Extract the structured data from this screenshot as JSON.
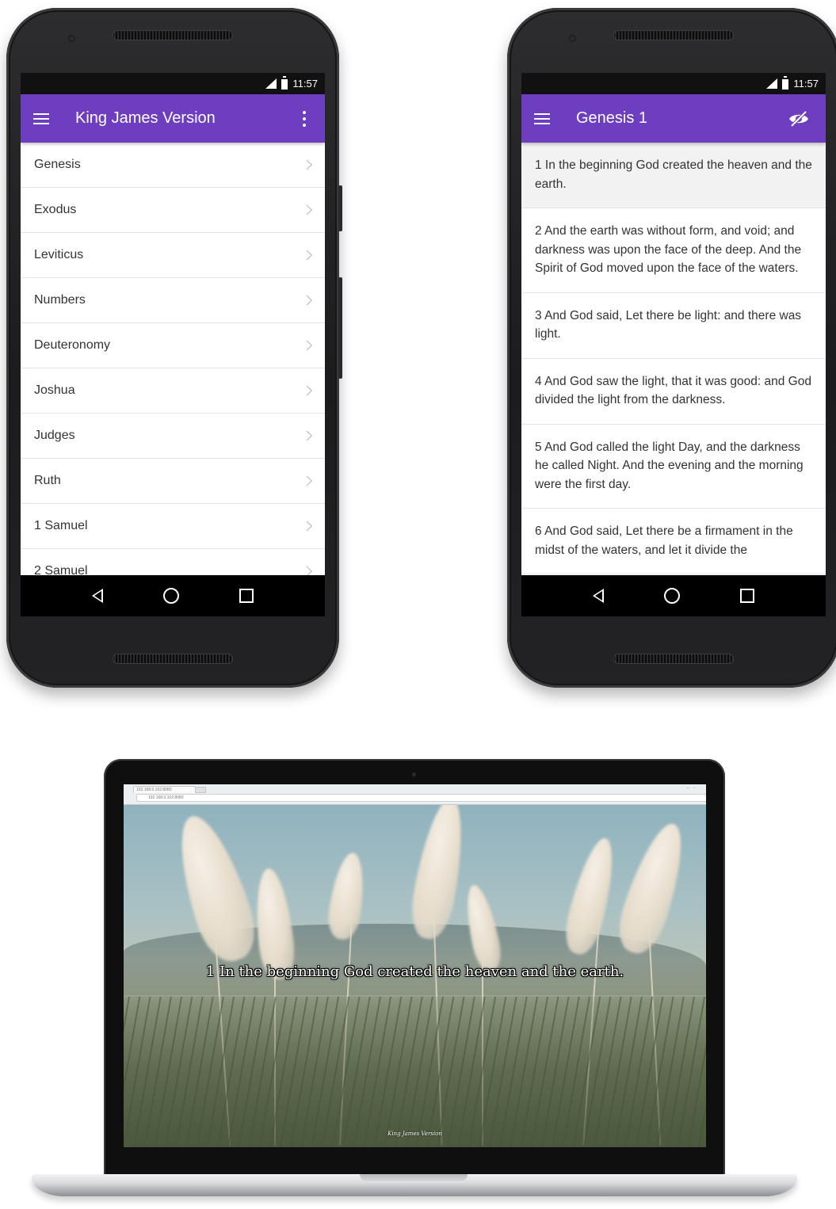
{
  "status_bar": {
    "time": "11:57"
  },
  "left_phone": {
    "app_title": "King James Version",
    "books": [
      "Genesis",
      "Exodus",
      "Leviticus",
      "Numbers",
      "Deuteronomy",
      "Joshua",
      "Judges",
      "Ruth",
      "1 Samuel",
      "2 Samuel"
    ]
  },
  "right_phone": {
    "app_title": "Genesis 1",
    "verses": [
      "1 In the beginning God created the heaven and the earth.",
      "2 And the earth was without form, and void; and darkness was upon the face of the deep. And the Spirit of God moved upon the face of the waters.",
      "3 And God said, Let there be light: and there was light.",
      "4 And God saw the light, that it was good: and God divided the light from the darkness.",
      "5 And God called the light Day, and the darkness he called Night. And the evening and the morning were the first day.",
      "6 And God said, Let there be a firmament in the midst of the waters, and let it divide the"
    ]
  },
  "laptop": {
    "browser": {
      "tab_title": "192.168.0.102:8080",
      "url": "192.168.0.102:8080"
    },
    "caption": "1 In the beginning God created the heaven and the earth.",
    "watermark": "King James Version"
  },
  "colors": {
    "app_bar": "#6d3fc0",
    "status_bar": "#111111",
    "nav_bar": "#000000"
  },
  "icons": {
    "app_bar_left": "hamburger-menu-icon",
    "left_app_bar_right": "overflow-menu-icon",
    "right_app_bar_right": "eye-off-icon",
    "list_row": "chevron-right-icon",
    "nav": [
      "back-icon",
      "home-icon",
      "recents-icon"
    ]
  }
}
